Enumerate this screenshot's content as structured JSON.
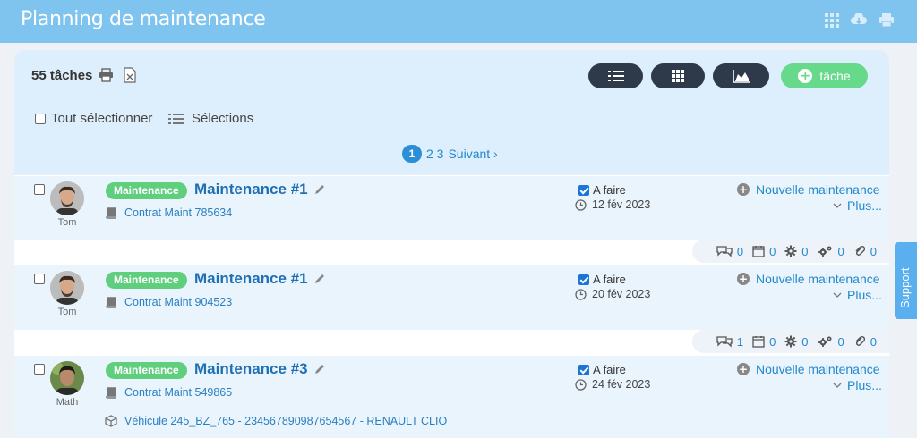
{
  "header": {
    "title": "Planning de maintenance",
    "icons": [
      "grid-icon",
      "cloud-download-icon",
      "print-icon"
    ]
  },
  "toolbar": {
    "count": "55 tâches",
    "views": [
      "list-view",
      "grid-view",
      "chart-view"
    ],
    "add_label": "tâche",
    "select_all": "Tout sélectionner",
    "selections": "Sélections"
  },
  "pagination": {
    "current": "1",
    "pages": "2 3",
    "next": "Suivant ›"
  },
  "tasks": [
    {
      "user": "Tom",
      "badge": "Maintenance",
      "title": "Maintenance #1",
      "contract": "Contrat Maint 785634",
      "status": "A faire",
      "date": "12 fév 2023",
      "action": "Nouvelle maintenance",
      "more": "Plus..."
    },
    {
      "user": "Tom",
      "badge": "Maintenance",
      "title": "Maintenance #1",
      "contract": "Contrat Maint 904523",
      "status": "A faire",
      "date": "20 fév 2023",
      "action": "Nouvelle maintenance",
      "more": "Plus..."
    },
    {
      "user": "Math",
      "badge": "Maintenance",
      "title": "Maintenance #3",
      "contract": "Contrat Maint 549865",
      "status": "A faire",
      "date": "24 fév 2023",
      "action": "Nouvelle maintenance",
      "more": "Plus...",
      "vehicle": "Véhicule 245_BZ_765 - 23456789098765­4567 - RENAULT CLIO"
    }
  ],
  "stats": [
    {
      "comments": "0",
      "events": "0",
      "settings": "0",
      "multi": "0",
      "attachments": "0"
    },
    {
      "comments": "1",
      "events": "0",
      "settings": "0",
      "multi": "0",
      "attachments": "0"
    }
  ],
  "support": {
    "label": "Support"
  },
  "colors": {
    "header": "#7ec4ef",
    "dark_button": "#2e3a4a",
    "add_button": "#67d98a",
    "badge": "#5fcf7d",
    "link": "#2288cc"
  }
}
